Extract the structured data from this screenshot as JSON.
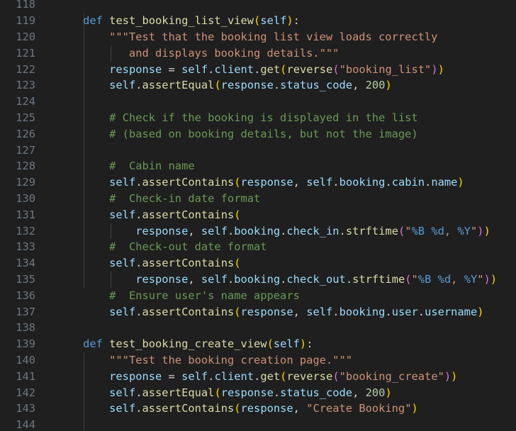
{
  "editor": {
    "language": "python",
    "colors": {
      "background": "#1f1f1f",
      "line_number": "#6e7681",
      "keyword": "#569cd6",
      "function": "#dcdcaa",
      "variable": "#9cdcfe",
      "string": "#ce9178",
      "number": "#b5cea8",
      "comment": "#6a9955",
      "bracket_level_1": "#ffd700",
      "bracket_level_2": "#da70d6",
      "bracket_level_3": "#179fff"
    },
    "lines": [
      {
        "number": "118",
        "tokens": []
      },
      {
        "number": "119",
        "tokens": [
          {
            "t": "    ",
            "c": "punc"
          },
          {
            "t": "def",
            "c": "kw"
          },
          {
            "t": " ",
            "c": "punc"
          },
          {
            "t": "test_booking_list_view",
            "c": "fn"
          },
          {
            "t": "(",
            "c": "b1"
          },
          {
            "t": "self",
            "c": "var"
          },
          {
            "t": ")",
            "c": "b1"
          },
          {
            "t": ":",
            "c": "punc"
          }
        ]
      },
      {
        "number": "120",
        "tokens": [
          {
            "t": "        ",
            "c": "punc"
          },
          {
            "t": "\"\"\"Test that the booking list view loads correctly",
            "c": "str"
          }
        ]
      },
      {
        "number": "121",
        "tokens": [
          {
            "t": "           and displays booking details.\"\"\"",
            "c": "str"
          }
        ]
      },
      {
        "number": "122",
        "tokens": [
          {
            "t": "        ",
            "c": "punc"
          },
          {
            "t": "response",
            "c": "var"
          },
          {
            "t": " = ",
            "c": "punc"
          },
          {
            "t": "self",
            "c": "var"
          },
          {
            "t": ".",
            "c": "punc"
          },
          {
            "t": "client",
            "c": "var"
          },
          {
            "t": ".",
            "c": "punc"
          },
          {
            "t": "get",
            "c": "fn"
          },
          {
            "t": "(",
            "c": "b1"
          },
          {
            "t": "reverse",
            "c": "fn"
          },
          {
            "t": "(",
            "c": "b2"
          },
          {
            "t": "\"booking_list\"",
            "c": "str"
          },
          {
            "t": ")",
            "c": "b2"
          },
          {
            "t": ")",
            "c": "b1"
          }
        ]
      },
      {
        "number": "123",
        "tokens": [
          {
            "t": "        ",
            "c": "punc"
          },
          {
            "t": "self",
            "c": "var"
          },
          {
            "t": ".",
            "c": "punc"
          },
          {
            "t": "assertEqual",
            "c": "fn"
          },
          {
            "t": "(",
            "c": "b1"
          },
          {
            "t": "response",
            "c": "var"
          },
          {
            "t": ".",
            "c": "punc"
          },
          {
            "t": "status_code",
            "c": "var"
          },
          {
            "t": ", ",
            "c": "punc"
          },
          {
            "t": "200",
            "c": "num"
          },
          {
            "t": ")",
            "c": "b1"
          }
        ]
      },
      {
        "number": "124",
        "tokens": []
      },
      {
        "number": "125",
        "tokens": [
          {
            "t": "        ",
            "c": "punc"
          },
          {
            "t": "# Check if the booking is displayed in the list",
            "c": "cmt"
          }
        ]
      },
      {
        "number": "126",
        "tokens": [
          {
            "t": "        ",
            "c": "punc"
          },
          {
            "t": "# (based on booking details, but not the image)",
            "c": "cmt"
          }
        ]
      },
      {
        "number": "127",
        "tokens": []
      },
      {
        "number": "128",
        "tokens": [
          {
            "t": "        ",
            "c": "punc"
          },
          {
            "t": "#  Cabin name",
            "c": "cmt"
          }
        ]
      },
      {
        "number": "129",
        "tokens": [
          {
            "t": "        ",
            "c": "punc"
          },
          {
            "t": "self",
            "c": "var"
          },
          {
            "t": ".",
            "c": "punc"
          },
          {
            "t": "assertContains",
            "c": "fn"
          },
          {
            "t": "(",
            "c": "b1"
          },
          {
            "t": "response",
            "c": "var"
          },
          {
            "t": ", ",
            "c": "punc"
          },
          {
            "t": "self",
            "c": "var"
          },
          {
            "t": ".",
            "c": "punc"
          },
          {
            "t": "booking",
            "c": "var"
          },
          {
            "t": ".",
            "c": "punc"
          },
          {
            "t": "cabin",
            "c": "var"
          },
          {
            "t": ".",
            "c": "punc"
          },
          {
            "t": "name",
            "c": "var"
          },
          {
            "t": ")",
            "c": "b1"
          }
        ]
      },
      {
        "number": "130",
        "tokens": [
          {
            "t": "        ",
            "c": "punc"
          },
          {
            "t": "#  Check-in date format",
            "c": "cmt"
          }
        ]
      },
      {
        "number": "131",
        "tokens": [
          {
            "t": "        ",
            "c": "punc"
          },
          {
            "t": "self",
            "c": "var"
          },
          {
            "t": ".",
            "c": "punc"
          },
          {
            "t": "assertContains",
            "c": "fn"
          },
          {
            "t": "(",
            "c": "b1"
          }
        ]
      },
      {
        "number": "132",
        "tokens": [
          {
            "t": "            ",
            "c": "punc"
          },
          {
            "t": "response",
            "c": "var"
          },
          {
            "t": ", ",
            "c": "punc"
          },
          {
            "t": "self",
            "c": "var"
          },
          {
            "t": ".",
            "c": "punc"
          },
          {
            "t": "booking",
            "c": "var"
          },
          {
            "t": ".",
            "c": "punc"
          },
          {
            "t": "check_in",
            "c": "var"
          },
          {
            "t": ".",
            "c": "punc"
          },
          {
            "t": "strftime",
            "c": "fn"
          },
          {
            "t": "(",
            "c": "b2"
          },
          {
            "t": "\"",
            "c": "str"
          },
          {
            "t": "%B",
            "c": "fmt"
          },
          {
            "t": " ",
            "c": "str"
          },
          {
            "t": "%d",
            "c": "fmt"
          },
          {
            "t": ", ",
            "c": "str"
          },
          {
            "t": "%Y",
            "c": "fmt"
          },
          {
            "t": "\"",
            "c": "str"
          },
          {
            "t": ")",
            "c": "b2"
          },
          {
            "t": ")",
            "c": "b1"
          }
        ]
      },
      {
        "number": "133",
        "tokens": [
          {
            "t": "        ",
            "c": "punc"
          },
          {
            "t": "#  Check-out date format",
            "c": "cmt"
          }
        ]
      },
      {
        "number": "134",
        "tokens": [
          {
            "t": "        ",
            "c": "punc"
          },
          {
            "t": "self",
            "c": "var"
          },
          {
            "t": ".",
            "c": "punc"
          },
          {
            "t": "assertContains",
            "c": "fn"
          },
          {
            "t": "(",
            "c": "b1"
          }
        ]
      },
      {
        "number": "135",
        "tokens": [
          {
            "t": "            ",
            "c": "punc"
          },
          {
            "t": "response",
            "c": "var"
          },
          {
            "t": ", ",
            "c": "punc"
          },
          {
            "t": "self",
            "c": "var"
          },
          {
            "t": ".",
            "c": "punc"
          },
          {
            "t": "booking",
            "c": "var"
          },
          {
            "t": ".",
            "c": "punc"
          },
          {
            "t": "check_out",
            "c": "var"
          },
          {
            "t": ".",
            "c": "punc"
          },
          {
            "t": "strftime",
            "c": "fn"
          },
          {
            "t": "(",
            "c": "b2"
          },
          {
            "t": "\"",
            "c": "str"
          },
          {
            "t": "%B",
            "c": "fmt"
          },
          {
            "t": " ",
            "c": "str"
          },
          {
            "t": "%d",
            "c": "fmt"
          },
          {
            "t": ", ",
            "c": "str"
          },
          {
            "t": "%Y",
            "c": "fmt"
          },
          {
            "t": "\"",
            "c": "str"
          },
          {
            "t": ")",
            "c": "b2"
          },
          {
            "t": ")",
            "c": "b1"
          }
        ]
      },
      {
        "number": "136",
        "tokens": [
          {
            "t": "        ",
            "c": "punc"
          },
          {
            "t": "#  Ensure user's name appears",
            "c": "cmt"
          }
        ]
      },
      {
        "number": "137",
        "tokens": [
          {
            "t": "        ",
            "c": "punc"
          },
          {
            "t": "self",
            "c": "var"
          },
          {
            "t": ".",
            "c": "punc"
          },
          {
            "t": "assertContains",
            "c": "fn"
          },
          {
            "t": "(",
            "c": "b1"
          },
          {
            "t": "response",
            "c": "var"
          },
          {
            "t": ", ",
            "c": "punc"
          },
          {
            "t": "self",
            "c": "var"
          },
          {
            "t": ".",
            "c": "punc"
          },
          {
            "t": "booking",
            "c": "var"
          },
          {
            "t": ".",
            "c": "punc"
          },
          {
            "t": "user",
            "c": "var"
          },
          {
            "t": ".",
            "c": "punc"
          },
          {
            "t": "username",
            "c": "var"
          },
          {
            "t": ")",
            "c": "b1"
          }
        ]
      },
      {
        "number": "138",
        "tokens": []
      },
      {
        "number": "139",
        "tokens": [
          {
            "t": "    ",
            "c": "punc"
          },
          {
            "t": "def",
            "c": "kw"
          },
          {
            "t": " ",
            "c": "punc"
          },
          {
            "t": "test_booking_create_view",
            "c": "fn"
          },
          {
            "t": "(",
            "c": "b1"
          },
          {
            "t": "self",
            "c": "var"
          },
          {
            "t": ")",
            "c": "b1"
          },
          {
            "t": ":",
            "c": "punc"
          }
        ]
      },
      {
        "number": "140",
        "tokens": [
          {
            "t": "        ",
            "c": "punc"
          },
          {
            "t": "\"\"\"Test the booking creation page.\"\"\"",
            "c": "str"
          }
        ]
      },
      {
        "number": "141",
        "tokens": [
          {
            "t": "        ",
            "c": "punc"
          },
          {
            "t": "response",
            "c": "var"
          },
          {
            "t": " = ",
            "c": "punc"
          },
          {
            "t": "self",
            "c": "var"
          },
          {
            "t": ".",
            "c": "punc"
          },
          {
            "t": "client",
            "c": "var"
          },
          {
            "t": ".",
            "c": "punc"
          },
          {
            "t": "get",
            "c": "fn"
          },
          {
            "t": "(",
            "c": "b1"
          },
          {
            "t": "reverse",
            "c": "fn"
          },
          {
            "t": "(",
            "c": "b2"
          },
          {
            "t": "\"booking_create\"",
            "c": "str"
          },
          {
            "t": ")",
            "c": "b2"
          },
          {
            "t": ")",
            "c": "b1"
          }
        ]
      },
      {
        "number": "142",
        "tokens": [
          {
            "t": "        ",
            "c": "punc"
          },
          {
            "t": "self",
            "c": "var"
          },
          {
            "t": ".",
            "c": "punc"
          },
          {
            "t": "assertEqual",
            "c": "fn"
          },
          {
            "t": "(",
            "c": "b1"
          },
          {
            "t": "response",
            "c": "var"
          },
          {
            "t": ".",
            "c": "punc"
          },
          {
            "t": "status_code",
            "c": "var"
          },
          {
            "t": ", ",
            "c": "punc"
          },
          {
            "t": "200",
            "c": "num"
          },
          {
            "t": ")",
            "c": "b1"
          }
        ]
      },
      {
        "number": "143",
        "tokens": [
          {
            "t": "        ",
            "c": "punc"
          },
          {
            "t": "self",
            "c": "var"
          },
          {
            "t": ".",
            "c": "punc"
          },
          {
            "t": "assertContains",
            "c": "fn"
          },
          {
            "t": "(",
            "c": "b1"
          },
          {
            "t": "response",
            "c": "var"
          },
          {
            "t": ", ",
            "c": "punc"
          },
          {
            "t": "\"Create Booking\"",
            "c": "str"
          },
          {
            "t": ")",
            "c": "b1"
          }
        ]
      },
      {
        "number": "144",
        "tokens": []
      }
    ]
  }
}
